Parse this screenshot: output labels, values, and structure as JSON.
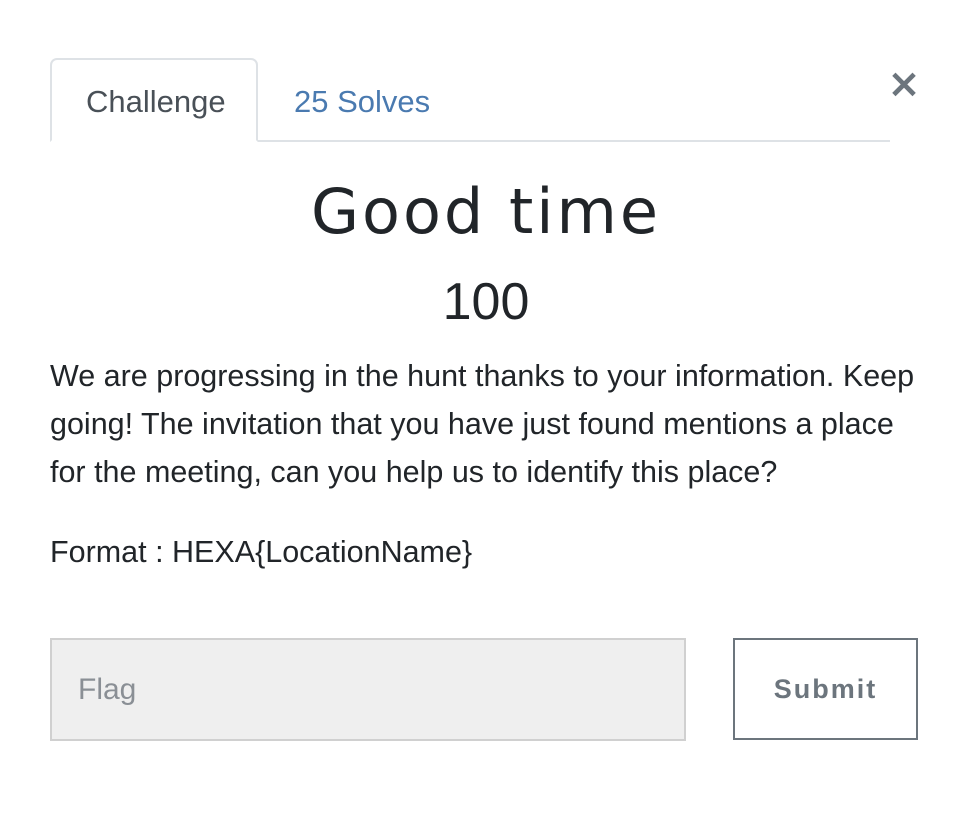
{
  "modal": {
    "close_glyph": "×",
    "tabs": [
      {
        "label": "Challenge",
        "active": true
      },
      {
        "label": "25 Solves",
        "active": false
      }
    ],
    "challenge": {
      "name": "Good time",
      "value": "100",
      "description": [
        "We are progressing in the hunt thanks to your information. Keep going! The invitation that you have just found mentions a place for the meeting, can you help us to identify this place?"
      ],
      "format": "Format : HEXA{LocationName}"
    },
    "submission": {
      "flag_value": "",
      "flag_placeholder": "Flag",
      "submit_label": "Submit"
    }
  },
  "colors": {
    "link": "#4a7ab0",
    "text": "#212529",
    "input_bg": "#efefef",
    "button_border": "#6c757d"
  }
}
